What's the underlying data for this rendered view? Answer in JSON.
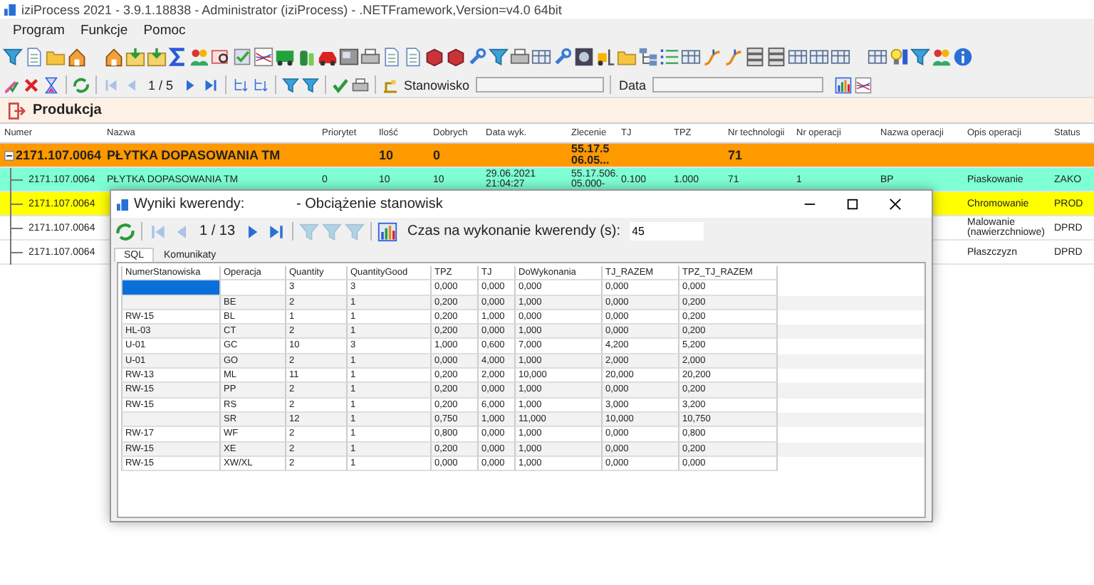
{
  "window": {
    "title": "iziProcess 2021 - 3.9.1.18838 - Administrator (iziProcess) - .NETFramework,Version=v4.0 64bit"
  },
  "menu": [
    "Program",
    "Funkcje",
    "Pomoc"
  ],
  "toolbar": {
    "pager": "1 / 5",
    "station_label": "Stanowisko",
    "date_label": "Data"
  },
  "section": {
    "title": "Produkcja"
  },
  "grid": {
    "columns": [
      "Numer",
      "Nazwa",
      "Priorytet",
      "Ilość",
      "Dobrych",
      "Data wyk.",
      "Zlecenie",
      "TJ",
      "TPZ",
      "Nr technologii",
      "Nr operacji",
      "Nazwa operacji",
      "Opis operacji",
      "Status"
    ],
    "rows": [
      {
        "expanded": true,
        "color": "#ff9900",
        "cells": [
          "2171.107.0064",
          "PŁYTKA DOPASOWANIA TM",
          null,
          "10",
          "0",
          null,
          "55.17.5\n06.05...",
          null,
          null,
          "71",
          null,
          null,
          null,
          null
        ],
        "children": [
          {
            "color": "#7fffd4",
            "cells": [
              "2171.107.0064",
              "PŁYTKA DOPASOWANIA TM",
              "0",
              "10",
              "10",
              "29.06.2021\n21:04:27",
              "55.17.506.\n05.000-",
              "0.100",
              "1.000",
              "71",
              "1",
              "BP",
              "Piaskowanie",
              "ZAKO"
            ]
          },
          {
            "color": "#ffff00",
            "cells": [
              "2171.107.0064",
              null,
              null,
              null,
              null,
              null,
              null,
              null,
              null,
              null,
              null,
              null,
              "Chromowanie",
              "PROD"
            ]
          },
          {
            "color": "#ffffff",
            "cells": [
              "2171.107.0064",
              null,
              null,
              null,
              null,
              null,
              null,
              null,
              null,
              null,
              null,
              null,
              "Malowanie (nawierzchniowe)",
              "DPRD"
            ]
          },
          {
            "color": "#ffffff",
            "cells": [
              "2171.107.0064",
              null,
              null,
              null,
              null,
              null,
              null,
              null,
              null,
              null,
              null,
              null,
              "Płaszczyzn",
              "DPRD"
            ]
          }
        ]
      }
    ]
  },
  "dialog": {
    "title": "Wyniki kwerendy:",
    "subtitle": "- Obciążenie stanowisk",
    "pager": "1 / 13",
    "timeout_label": "Czas na wykonanie kwerendy (s):",
    "timeout_value": "45",
    "tabs": [
      {
        "label": "SQL",
        "selected": true
      },
      {
        "label": "Komunikaty",
        "selected": false
      }
    ],
    "table": {
      "columns": [
        "NumerStanowiska",
        "Operacja",
        "Quantity",
        "QuantityGood",
        "TPZ",
        "TJ",
        "DoWykonania",
        "TJ_RAZEM",
        "TPZ_TJ_RAZEM"
      ],
      "rows": [
        {
          "selected": true,
          "cells": [
            null,
            null,
            "3",
            "3",
            "0,000",
            "0,000",
            "0,000",
            "0,000",
            "0,000"
          ]
        },
        {
          "selected": false,
          "cells": [
            null,
            "BE",
            "2",
            "1",
            "0,200",
            "0,000",
            "1,000",
            "0,000",
            "0,200"
          ]
        },
        {
          "selected": false,
          "cells": [
            "RW-15",
            "BL",
            "1",
            "1",
            "0,200",
            "1,000",
            "0,000",
            "0,000",
            "0,200"
          ]
        },
        {
          "selected": false,
          "cells": [
            "HL-03",
            "CT",
            "2",
            "1",
            "0,200",
            "0,000",
            "1,000",
            "0,000",
            "0,200"
          ]
        },
        {
          "selected": false,
          "cells": [
            "U-01",
            "GC",
            "10",
            "3",
            "1,000",
            "0,600",
            "7,000",
            "4,200",
            "5,200"
          ]
        },
        {
          "selected": false,
          "cells": [
            "U-01",
            "GO",
            "2",
            "1",
            "0,000",
            "4,000",
            "1,000",
            "2,000",
            "2,000"
          ]
        },
        {
          "selected": false,
          "cells": [
            "RW-13",
            "ML",
            "11",
            "1",
            "0,200",
            "2,000",
            "10,000",
            "20,000",
            "20,200"
          ]
        },
        {
          "selected": false,
          "cells": [
            "RW-15",
            "PP",
            "2",
            "1",
            "0,200",
            "0,000",
            "1,000",
            "0,000",
            "0,200"
          ]
        },
        {
          "selected": false,
          "cells": [
            "RW-15",
            "RS",
            "2",
            "1",
            "0,200",
            "6,000",
            "1,000",
            "3,000",
            "3,200"
          ]
        },
        {
          "selected": false,
          "cells": [
            null,
            "SR",
            "12",
            "1",
            "0,750",
            "1,000",
            "11,000",
            "10,000",
            "10,750"
          ]
        },
        {
          "selected": false,
          "cells": [
            "RW-17",
            "WF",
            "2",
            "1",
            "0,800",
            "0,000",
            "1,000",
            "0,000",
            "0,800"
          ]
        },
        {
          "selected": false,
          "cells": [
            "RW-15",
            "XE",
            "2",
            "1",
            "0,200",
            "0,000",
            "1,000",
            "0,000",
            "0,200"
          ]
        },
        {
          "selected": false,
          "cells": [
            "RW-15",
            "XW/XL",
            "2",
            "1",
            "0,000",
            "0,000",
            "1,000",
            "0,000",
            "0,000"
          ]
        }
      ]
    }
  }
}
